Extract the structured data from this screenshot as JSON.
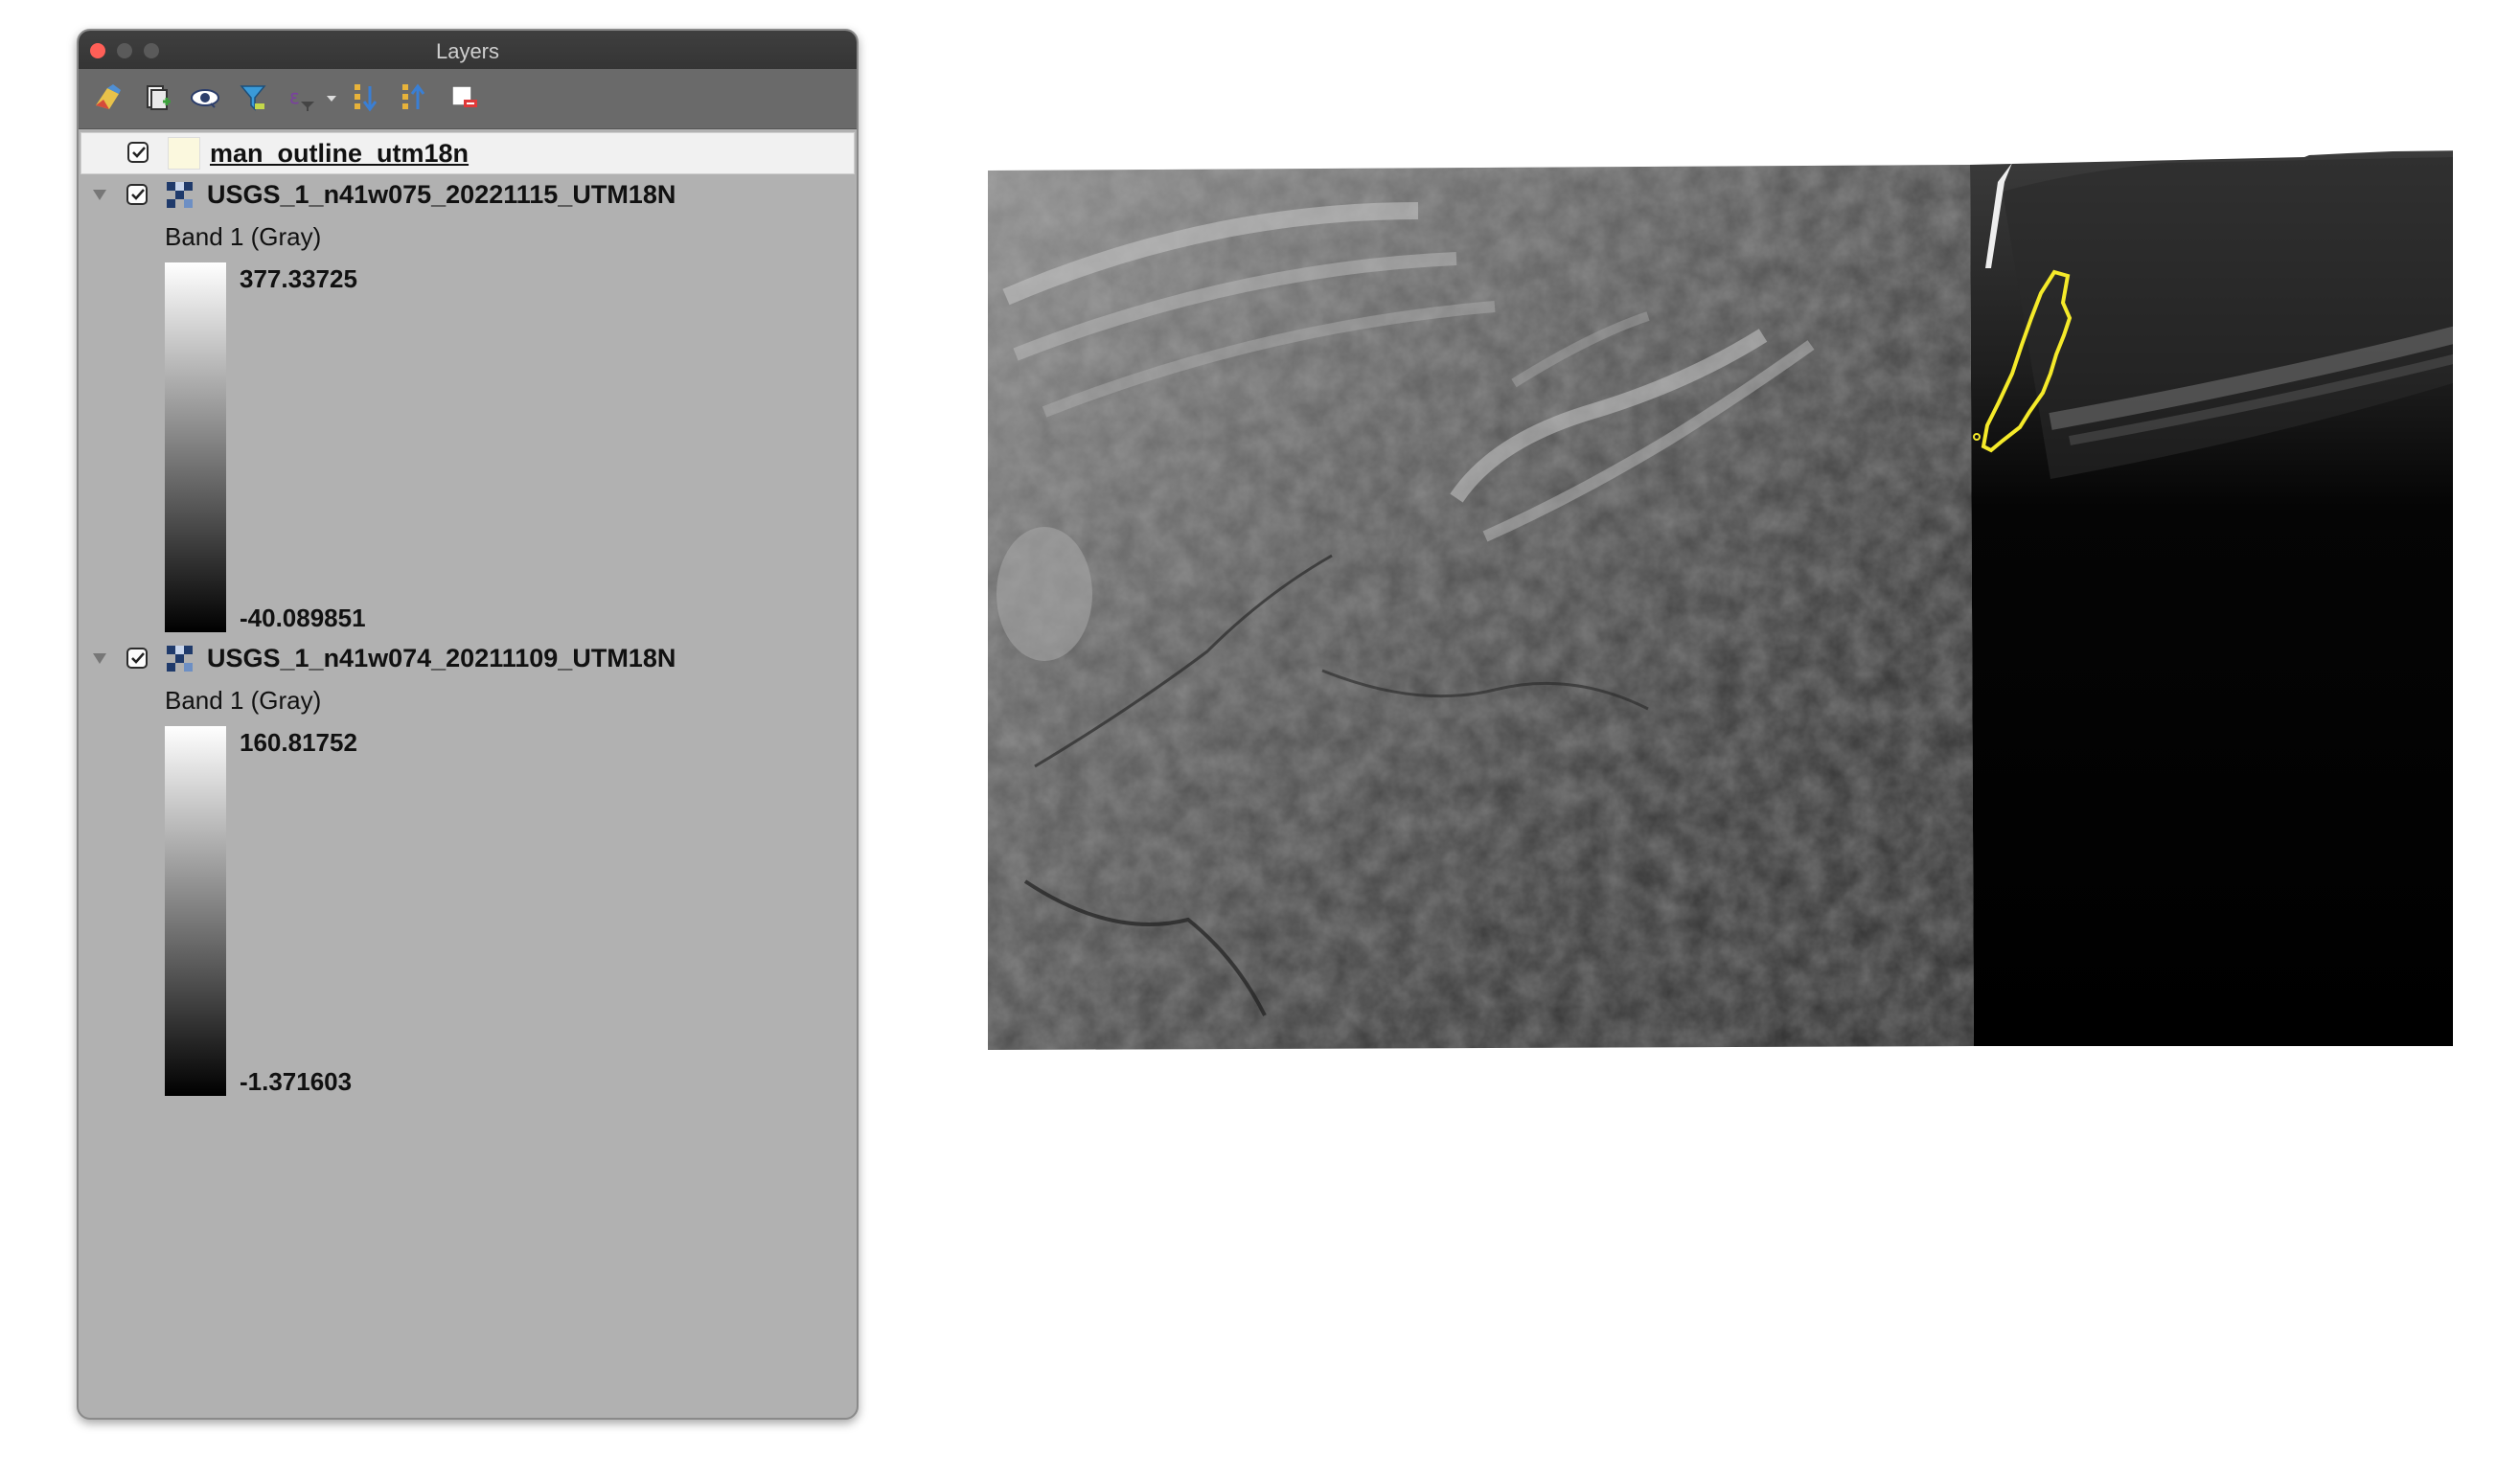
{
  "window": {
    "title": "Layers"
  },
  "toolbar": {
    "icons": [
      "open-layer-styling-icon",
      "add-group-icon",
      "manage-visibility-icon",
      "filter-legend-icon",
      "filter-by-expression-icon",
      "expand-all-icon",
      "collapse-all-icon",
      "remove-layer-icon"
    ]
  },
  "layers": [
    {
      "name": "man_outline_utm18n",
      "checked": true,
      "type": "vector",
      "swatch_color": "#fbf8de"
    },
    {
      "name": "USGS_1_n41w075_20221115_UTM18N",
      "checked": true,
      "type": "raster",
      "band": "Band 1 (Gray)",
      "max": "377.33725",
      "min": "-40.089851"
    },
    {
      "name": "USGS_1_n41w074_20211109_UTM18N",
      "checked": true,
      "type": "raster",
      "band": "Band 1 (Gray)",
      "max": "160.81752",
      "min": "-1.371603"
    }
  ],
  "map": {
    "outline_color": "#f5ea2a"
  }
}
